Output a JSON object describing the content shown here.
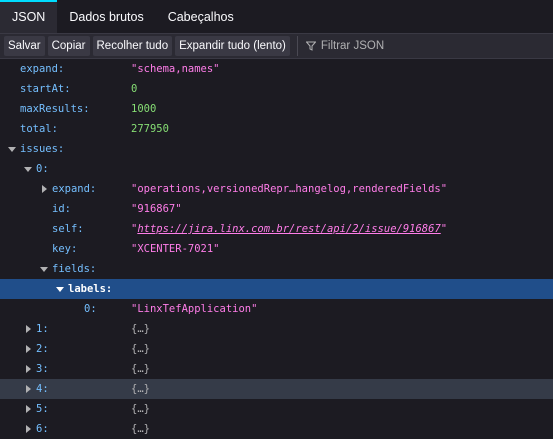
{
  "tabs": [
    {
      "label": "JSON",
      "selected": true
    },
    {
      "label": "Dados brutos",
      "selected": false
    },
    {
      "label": "Cabeçalhos",
      "selected": false
    }
  ],
  "toolbar": {
    "save_label": "Salvar",
    "copy_label": "Copiar",
    "collapse_label": "Recolher tudo",
    "expand_label": "Expandir tudo (lento)",
    "filter_placeholder": "Filtrar JSON"
  },
  "tree": {
    "expand": {
      "key": "expand:",
      "value": "\"schema,names\""
    },
    "startAt": {
      "key": "startAt:",
      "value": "0"
    },
    "maxResults": {
      "key": "maxResults:",
      "value": "1000"
    },
    "total": {
      "key": "total:",
      "value": "277950"
    },
    "issues": {
      "key": "issues:"
    },
    "issue0": {
      "key": "0:"
    },
    "issue0_expand": {
      "key": "expand:",
      "value": "\"operations,versionedRepr…hangelog,renderedFields\""
    },
    "issue0_id": {
      "key": "id:",
      "value": "\"916867\""
    },
    "issue0_self": {
      "key": "self:",
      "value": "https://jira.linx.com.br/rest/api/2/issue/916867",
      "quote": "\""
    },
    "issue0_key": {
      "key": "key:",
      "value": "\"XCENTER-7021\""
    },
    "fields": {
      "key": "fields:"
    },
    "labels": {
      "key": "labels:"
    },
    "label0": {
      "key": "0:",
      "value": "\"LinxTefApplication\""
    },
    "issue1": {
      "key": "1:",
      "value": "{…}"
    },
    "issue2": {
      "key": "2:",
      "value": "{…}"
    },
    "issue3": {
      "key": "3:",
      "value": "{…}"
    },
    "issue4": {
      "key": "4:",
      "value": "{…}"
    },
    "issue5": {
      "key": "5:",
      "value": "{…}"
    },
    "issue6": {
      "key": "6:",
      "value": "{…}"
    }
  }
}
